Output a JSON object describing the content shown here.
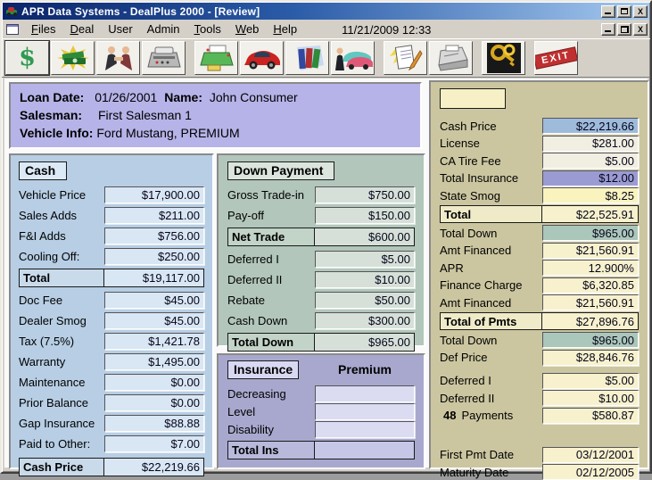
{
  "window": {
    "title": "APR Data Systems - DealPlus 2000 - [Review]",
    "close_glyph": "X"
  },
  "menu": {
    "items": [
      {
        "u": "F",
        "rest": "iles"
      },
      {
        "u": "D",
        "rest": "eal"
      },
      {
        "u": "",
        "rest": "User"
      },
      {
        "u": "",
        "rest": "Admin"
      },
      {
        "u": "T",
        "rest": "ools"
      },
      {
        "u": "W",
        "rest": "eb"
      },
      {
        "u": "H",
        "rest": "elp"
      }
    ],
    "datetime": "11/21/2009 12:33"
  },
  "toolbar": {
    "dollar_glyph": "$",
    "exit_label": "EXIT",
    "buttons": [
      "dollar",
      "cash",
      "handshake",
      "adding-machine",
      "printer",
      "car",
      "books",
      "dealer-cars",
      "worksheet",
      "fax",
      "keys",
      "exit"
    ]
  },
  "header": {
    "loan_date_label": "Loan Date:",
    "loan_date": "01/26/2001",
    "name_label": "Name:",
    "name": "John Consumer",
    "salesman_label": "Salesman:",
    "salesman": "First Salesman 1",
    "vehicle_label": "Vehicle Info:",
    "vehicle": "Ford Mustang, PREMIUM"
  },
  "cash_panel": {
    "title": "Cash",
    "rows": [
      {
        "label": "Vehicle Price",
        "value": "$17,900.00"
      },
      {
        "label": "Sales Adds",
        "value": "$211.00"
      },
      {
        "label": "F&I Adds",
        "value": "$756.00"
      },
      {
        "label": "Cooling Off:",
        "value": "$250.00"
      },
      {
        "label": "Total",
        "value": "$19,117.00"
      },
      {
        "label": "Doc Fee",
        "value": "$45.00"
      },
      {
        "label": "Dealer Smog",
        "value": "$45.00"
      },
      {
        "label": "Tax (7.5%)",
        "value": "$1,421.78"
      },
      {
        "label": "Warranty",
        "value": "$1,495.00"
      },
      {
        "label": "Maintenance",
        "value": "$0.00"
      },
      {
        "label": "Prior Balance",
        "value": "$0.00"
      },
      {
        "label": "Gap Insurance",
        "value": "$88.88"
      },
      {
        "label": "Paid to Other:",
        "value": "$7.00"
      },
      {
        "label": "Cash Price",
        "value": "$22,219.66"
      }
    ]
  },
  "down_panel": {
    "title": "Down Payment",
    "rows": [
      {
        "label": "Gross Trade-in",
        "value": "$750.00"
      },
      {
        "label": "Pay-off",
        "value": "$150.00"
      },
      {
        "label": "Net Trade",
        "value": "$600.00"
      },
      {
        "label": "Deferred I",
        "value": "$5.00"
      },
      {
        "label": "Deferred II",
        "value": "$10.00"
      },
      {
        "label": "Rebate",
        "value": "$50.00"
      },
      {
        "label": "Cash Down",
        "value": "$300.00"
      },
      {
        "label": "Total Down",
        "value": "$965.00"
      }
    ]
  },
  "insurance_panel": {
    "title": "Insurance",
    "column_header": "Premium",
    "rows": [
      {
        "label": "Decreasing",
        "value": ""
      },
      {
        "label": "Level",
        "value": ""
      },
      {
        "label": "Disability",
        "value": ""
      },
      {
        "label": "Total Ins",
        "value": ""
      }
    ]
  },
  "right_panel": {
    "rows": [
      {
        "label": "Cash Price",
        "value": "$22,219.66"
      },
      {
        "label": "License",
        "value": "$281.00"
      },
      {
        "label": "CA Tire Fee",
        "value": "$5.00"
      },
      {
        "label": "Total Insurance",
        "value": "$12.00"
      },
      {
        "label": "State Smog",
        "value": "$8.25"
      },
      {
        "label": "Total",
        "value": "$22,525.91"
      },
      {
        "label": "Total Down",
        "value": "$965.00"
      },
      {
        "label": "Amt Financed",
        "value": "$21,560.91"
      },
      {
        "label": "APR",
        "value": "12.900%"
      },
      {
        "label": "Finance Charge",
        "value": "$6,320.85"
      },
      {
        "label": "Amt Financed",
        "value": "$21,560.91"
      },
      {
        "label": "Total of Pmts",
        "value": "$27,896.76"
      },
      {
        "label": "Total Down",
        "value": "$965.00"
      },
      {
        "label": "Def Price",
        "value": "$28,846.76"
      },
      {
        "label": "Deferred I",
        "value": "$5.00"
      },
      {
        "label": "Deferred II",
        "value": "$10.00"
      },
      {
        "num": "48",
        "label": "Payments",
        "value": "$580.87"
      },
      {
        "label": "First Pmt Date",
        "value": "03/12/2001"
      },
      {
        "label": "Maturity Date",
        "value": "02/12/2005"
      }
    ]
  },
  "colors": {
    "titlebar_left": "#0A246A",
    "titlebar_right": "#A6CAF0",
    "chrome": "#D4D0C8",
    "header_bg": "#B6B3E8",
    "cash_bg": "#B7CEE4",
    "down_bg": "#B2C6BB",
    "insurance_bg": "#A8A8CE",
    "right_bg": "#CBC6A0",
    "field_blue": "#9FBBDB",
    "field_purple": "#9B9BD3",
    "field_yellow": "#F9F3BE",
    "field_green": "#ABC6BA",
    "field_cream": "#F7F1CD",
    "exit_red": "#C03030"
  }
}
